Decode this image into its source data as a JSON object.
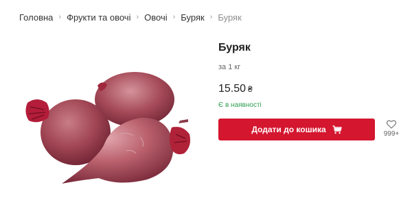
{
  "breadcrumb": {
    "items": [
      "Головна",
      "Фрукти та овочі",
      "Овочі",
      "Буряк"
    ],
    "current": "Буряк"
  },
  "product": {
    "title": "Буряк",
    "unit": "за 1 кг",
    "price": "15.50",
    "currency": "₴",
    "stock": "Є в наявності",
    "add_to_cart_label": "Додати до кошика",
    "wishlist_count": "999+",
    "image_icon": "beetroot-image"
  },
  "colors": {
    "accent": "#d4162f",
    "in_stock": "#2e9e4f"
  }
}
